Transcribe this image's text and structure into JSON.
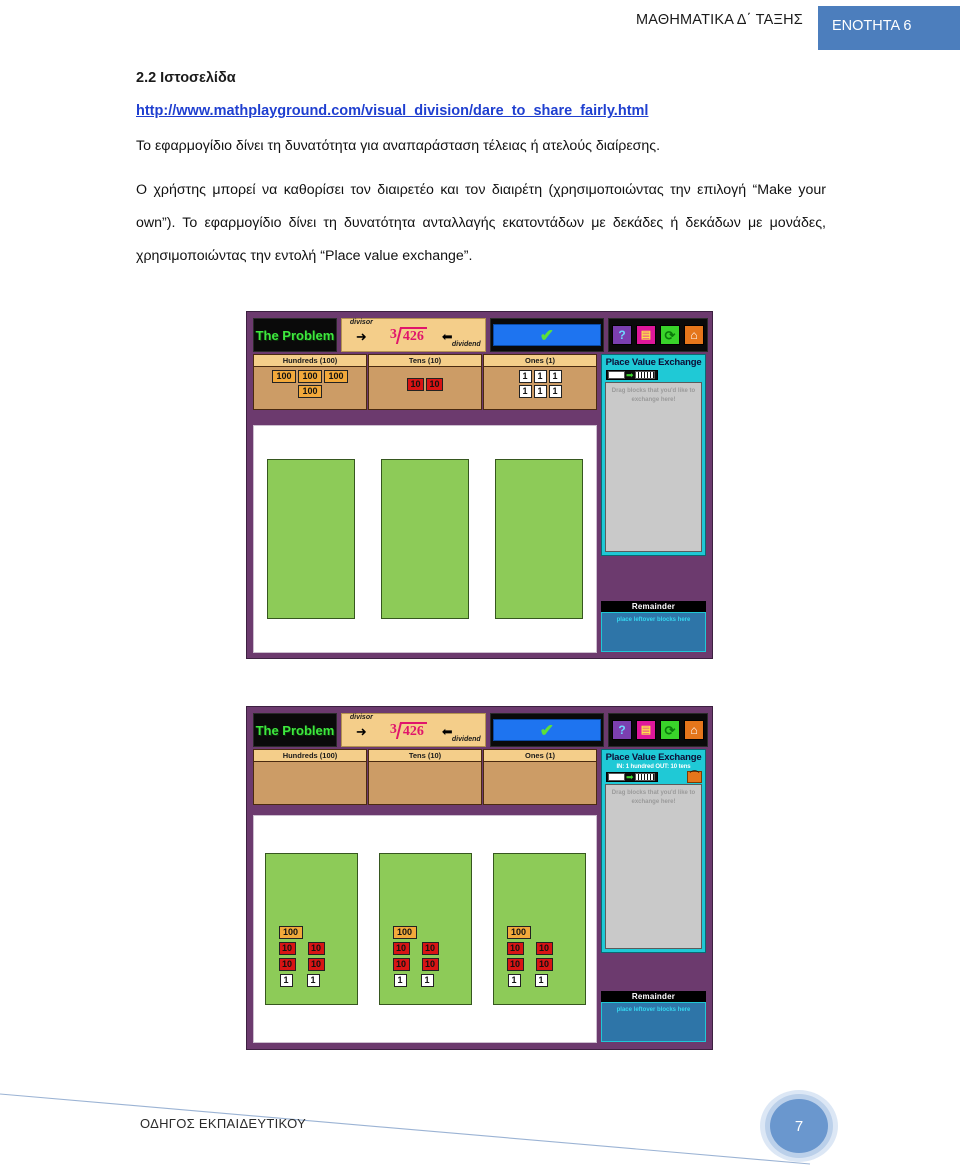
{
  "header": {
    "course_title": "ΜΑΘΗΜΑΤΙΚΑ Δ΄ ΤΑΞΗΣ",
    "unit_badge": "ΕΝΟΤΗΤΑ 6",
    "badge_color": "#4C7EBD"
  },
  "section": {
    "number_title": "2.2 Ιστοσελίδα",
    "url": "http://www.mathplayground.com/visual_division/dare_to_share_fairly.html",
    "paragraph_1": "Το εφαρμογίδιο δίνει τη δυνατότητα για αναπαράσταση τέλειας ή ατελούς διαίρεσης.",
    "paragraph_2": "Ο χρήστης μπορεί να καθορίσει τον διαιρετέο και τον διαιρέτη (χρησιμοποιώντας την επιλογή “Make your own”). Το εφαρμογίδιο δίνει τη δυνατότητα ανταλλαγής εκατοντάδων με δεκάδες ή δεκάδων με μονάδες, χρησιμοποιώντας την εντολή “Place value exchange”."
  },
  "applet_common": {
    "problem_label": "The Problem",
    "divisor_label": "divisor",
    "dividend_label": "dividend",
    "divisor_value": "3",
    "dividend_value": "426",
    "check_symbol": "✔",
    "icons": {
      "help": "?",
      "list": "▤",
      "refresh": "⟳",
      "home": "⌂"
    },
    "columns": [
      {
        "header": "Hundreds (100)"
      },
      {
        "header": "Tens (10)"
      },
      {
        "header": "Ones (1)"
      }
    ],
    "pve_title": "Place Value Exchange",
    "pve_hint_line1": "Drag blocks that you'd like to",
    "pve_hint_line2": "exchange here!",
    "remainder_title": "Remainder",
    "remainder_hint": "place leftover blocks here",
    "block_hundred": "100",
    "block_ten": "10",
    "block_one": "1",
    "swatch_arrow": "➡",
    "undo_glyph": "⌒"
  },
  "applet_one": {
    "caption": "Initial state: 426 shown as 4 hundreds, 2 tens, 6 ones; three empty share boxes",
    "hundreds_count": 4,
    "tens_count": 2,
    "ones_count": 6,
    "pve_subtitle": "",
    "share_boxes": 3,
    "share_box_contents": "empty"
  },
  "applet_two": {
    "caption": "After sharing: each of three boxes holds 1 hundred, 4 tens, 2 ones = 142",
    "hundreds_count": 0,
    "tens_count": 0,
    "ones_count": 0,
    "pve_subtitle": "IN: 1 hundred   OUT: 10 tens",
    "share_boxes": 3,
    "per_box": {
      "hundreds": 1,
      "tens": 4,
      "ones": 2
    }
  },
  "footer": {
    "label": "ΟΔΗΓΟΣ ΕΚΠΑΙΔΕΥΤΙΚΟΥ",
    "page_number": "7"
  }
}
